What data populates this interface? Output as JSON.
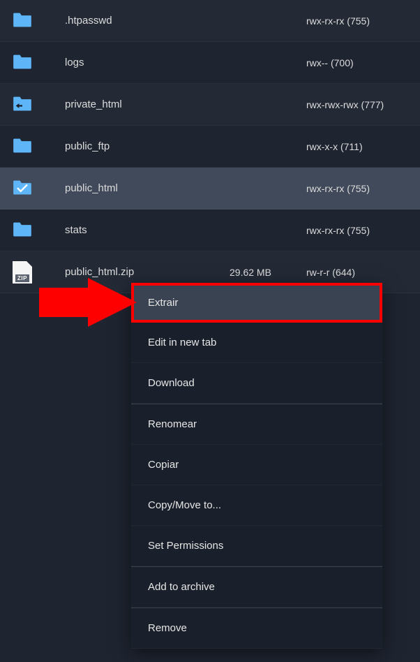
{
  "files": [
    {
      "name": ".htpasswd",
      "size": "",
      "perm": "rwx-rx-rx (755)",
      "type": "folder",
      "selected": false
    },
    {
      "name": "logs",
      "size": "",
      "perm": "rwx-- (700)",
      "type": "folder",
      "selected": false
    },
    {
      "name": "private_html",
      "size": "",
      "perm": "rwx-rwx-rwx (777)",
      "type": "symlink",
      "selected": false
    },
    {
      "name": "public_ftp",
      "size": "",
      "perm": "rwx-x-x (711)",
      "type": "folder",
      "selected": false
    },
    {
      "name": "public_html",
      "size": "",
      "perm": "rwx-rx-rx (755)",
      "type": "folder",
      "selected": true
    },
    {
      "name": "stats",
      "size": "",
      "perm": "rwx-rx-rx (755)",
      "type": "folder",
      "selected": false
    },
    {
      "name": "public_html.zip",
      "size": "29.62 MB",
      "perm": "rw-r-r (644)",
      "type": "zip",
      "selected": false
    }
  ],
  "context_menu": {
    "items": [
      {
        "label": "Extrair",
        "highlight": true
      },
      {
        "label": "Edit in new tab",
        "highlight": false
      },
      {
        "label": "Download",
        "highlight": false
      },
      {
        "label": "Renomear",
        "highlight": false,
        "divider": true
      },
      {
        "label": "Copiar",
        "highlight": false
      },
      {
        "label": "Copy/Move to...",
        "highlight": false
      },
      {
        "label": "Set Permissions",
        "highlight": false
      },
      {
        "label": "Add to archive",
        "highlight": false,
        "divider": true
      },
      {
        "label": "Remove",
        "highlight": false,
        "divider": true
      }
    ]
  },
  "zip_badge": "ZIP",
  "colors": {
    "folder": "#5eb5f7",
    "highlight_border": "#ff0000",
    "arrow": "#ff0000"
  }
}
